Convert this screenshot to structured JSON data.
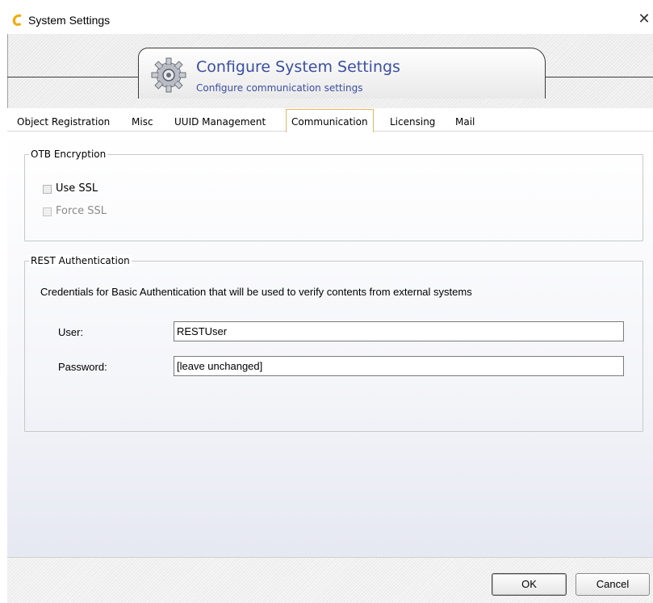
{
  "window": {
    "title": "System Settings",
    "close_glyph": "✕",
    "accent": "#f5a800"
  },
  "header": {
    "title": "Configure System Settings",
    "subtitle": "Configure communication settings",
    "icon": "gear-icon",
    "title_color": "#3a4fa3"
  },
  "tabs": [
    {
      "label": "Object Registration",
      "active": false
    },
    {
      "label": "Misc",
      "active": false
    },
    {
      "label": "UUID Management",
      "active": false
    },
    {
      "label": "Communication",
      "active": true
    },
    {
      "label": "Licensing",
      "active": false
    },
    {
      "label": "Mail",
      "active": false
    }
  ],
  "otb": {
    "legend": "OTB Encryption",
    "use_ssl": {
      "label": "Use SSL",
      "checked": false,
      "enabled": true
    },
    "force_ssl": {
      "label": "Force SSL",
      "checked": false,
      "enabled": false
    }
  },
  "rest": {
    "legend": "REST Authentication",
    "description": "Credentials for Basic Authentication that will be used to verify contents from external systems",
    "user_label": "User:",
    "user_value": "RESTUser",
    "password_label": "Password:",
    "password_value": "[leave unchanged]"
  },
  "footer": {
    "ok_label": "OK",
    "cancel_label": "Cancel"
  }
}
